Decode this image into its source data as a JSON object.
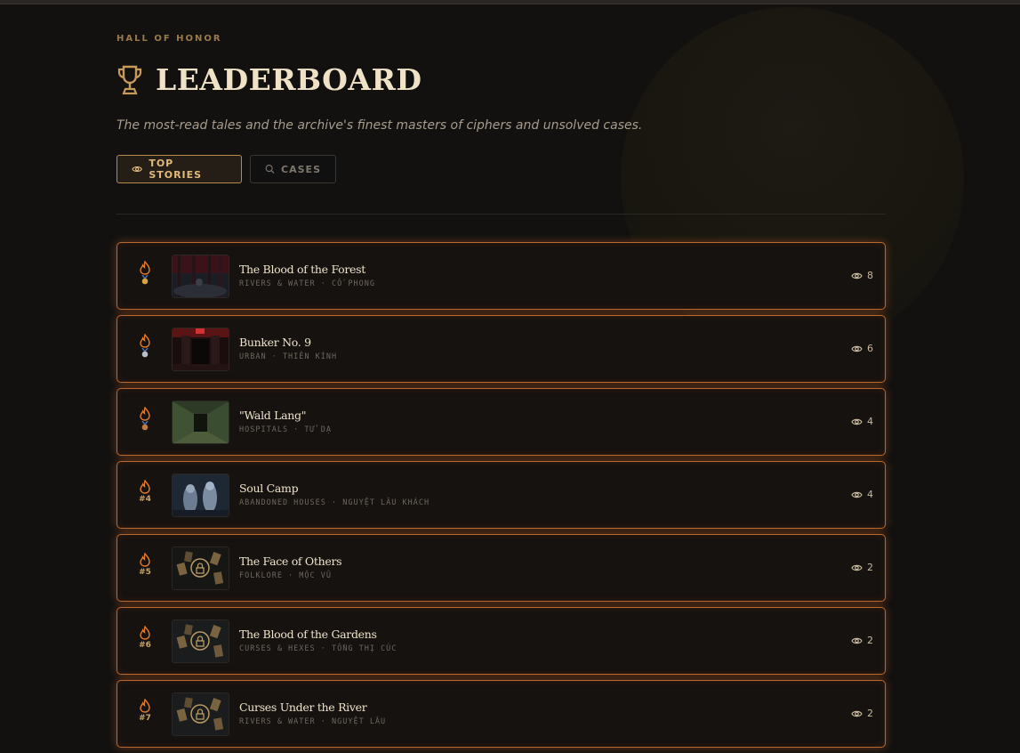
{
  "header": {
    "eyebrow": "HALL OF HONOR",
    "title": "LEADERBOARD",
    "subtitle": "The most-read tales and the archive's finest masters of ciphers and unsolved cases."
  },
  "tabs": [
    {
      "label": "TOP STORIES",
      "icon": "eye-icon",
      "active": true
    },
    {
      "label": "CASES",
      "icon": "search-icon",
      "active": false
    }
  ],
  "colors": {
    "accent": "#e2b978",
    "row_border": "#b8682e",
    "background": "#121110"
  },
  "stories": [
    {
      "rank": "#1",
      "badge": "gold-medal",
      "title": "The Blood of the Forest",
      "meta": "RIVERS & WATER · CỐ PHONG",
      "views": "8",
      "thumb": "forest"
    },
    {
      "rank": "#2",
      "badge": "silver-medal",
      "title": "Bunker No. 9",
      "meta": "URBAN · THIÊN KÍNH",
      "views": "6",
      "thumb": "bunker"
    },
    {
      "rank": "#3",
      "badge": "bronze-medal",
      "title": "\"Wald Lang\"",
      "meta": "HOSPITALS · TỬ DẠ",
      "views": "4",
      "thumb": "hallway"
    },
    {
      "rank": "#4",
      "badge": "",
      "title": "Soul Camp",
      "meta": "ABANDONED HOUSES · NGUYỆT LÂU KHÁCH",
      "views": "4",
      "thumb": "ghosts"
    },
    {
      "rank": "#5",
      "badge": "",
      "title": "The Face of Others",
      "meta": "FOLKLORE · MỘC VŨ",
      "views": "2",
      "thumb": "locked"
    },
    {
      "rank": "#6",
      "badge": "",
      "title": "The Blood of the Gardens",
      "meta": "CURSES & HEXES · TỐNG THỊ CÚC",
      "views": "2",
      "thumb": "locked"
    },
    {
      "rank": "#7",
      "badge": "",
      "title": "Curses Under the River",
      "meta": "RIVERS & WATER · NGUYỆT LÂU",
      "views": "2",
      "thumb": "locked"
    }
  ]
}
